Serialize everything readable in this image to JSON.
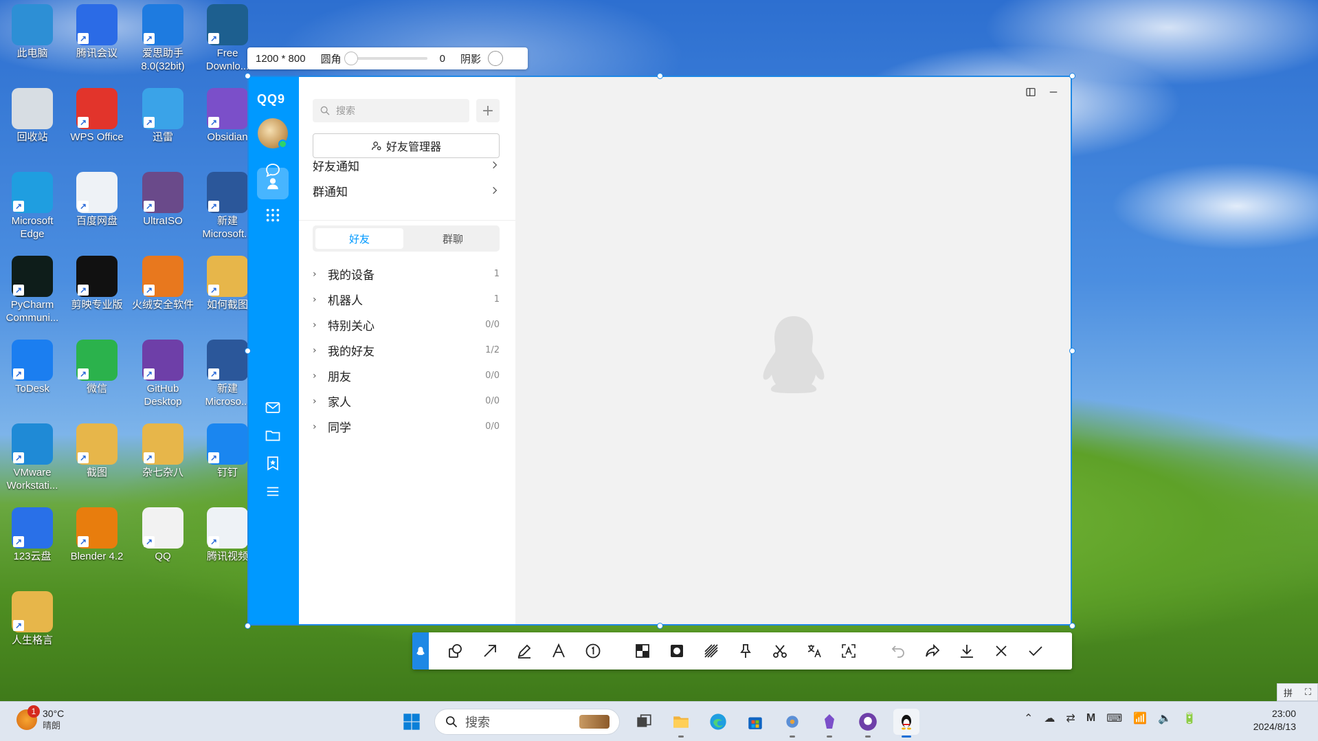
{
  "desktop": {
    "icons": [
      {
        "label": "此电脑",
        "icon": "computer-icon",
        "color": "#2d8fd5"
      },
      {
        "label": "腾讯会议",
        "icon": "tencent-meeting-icon",
        "color": "#2b6be6"
      },
      {
        "label": "爱思助手 8.0(32bit)",
        "icon": "i4-icon",
        "color": "#1e7be0"
      },
      {
        "label": "Free Downlo...",
        "icon": "free-download-icon",
        "color": "#1d5f8f"
      },
      {
        "label": "回收站",
        "icon": "recycle-bin-icon",
        "color": "#d7dde3"
      },
      {
        "label": "WPS Office",
        "icon": "wps-icon",
        "color": "#e2342b"
      },
      {
        "label": "迅雷",
        "icon": "xunlei-icon",
        "color": "#3aa3e8"
      },
      {
        "label": "Obsidian",
        "icon": "obsidian-icon",
        "color": "#7b4fc9"
      },
      {
        "label": "Microsoft Edge",
        "icon": "edge-icon",
        "color": "#1f9ee0"
      },
      {
        "label": "百度网盘",
        "icon": "baidu-pan-icon",
        "color": "#eef2f6"
      },
      {
        "label": "UltraISO",
        "icon": "ultraiso-icon",
        "color": "#6a4a8a"
      },
      {
        "label": "新建 Microsoft...",
        "icon": "word-doc-icon",
        "color": "#2b579a"
      },
      {
        "label": "PyCharm Communi...",
        "icon": "pycharm-icon",
        "color": "#0e1d1a"
      },
      {
        "label": "剪映专业版",
        "icon": "capcut-icon",
        "color": "#111111"
      },
      {
        "label": "火绒安全软件",
        "icon": "huorong-icon",
        "color": "#e8781e"
      },
      {
        "label": "如何截图",
        "icon": "folder-icon",
        "color": "#e7b64a"
      },
      {
        "label": "ToDesk",
        "icon": "todesk-icon",
        "color": "#1b7ef0"
      },
      {
        "label": "微信",
        "icon": "wechat-icon",
        "color": "#2bb24c"
      },
      {
        "label": "GitHub Desktop",
        "icon": "github-icon",
        "color": "#6e3fa8"
      },
      {
        "label": "新建 Microso...",
        "icon": "word-doc-icon",
        "color": "#2b579a"
      },
      {
        "label": "VMware Workstati...",
        "icon": "vmware-icon",
        "color": "#1f8ad6"
      },
      {
        "label": "截图",
        "icon": "folder-icon",
        "color": "#e7b64a"
      },
      {
        "label": "杂七杂八",
        "icon": "folder-icon",
        "color": "#e7b64a"
      },
      {
        "label": "钉钉",
        "icon": "dingtalk-icon",
        "color": "#1a86f0"
      },
      {
        "label": "123云盘",
        "icon": "123pan-icon",
        "color": "#2970e8"
      },
      {
        "label": "Blender 4.2",
        "icon": "blender-icon",
        "color": "#e87d0d"
      },
      {
        "label": "QQ",
        "icon": "qq-icon",
        "color": "#f2f2f2"
      },
      {
        "label": "腾讯视频",
        "icon": "tencent-video-icon",
        "color": "#eef2f6"
      },
      {
        "label": "人生格言",
        "icon": "folder-icon",
        "color": "#e7b64a"
      }
    ]
  },
  "sizebar": {
    "dims": "1200 * 800",
    "radius_label": "圆角",
    "radius_value": "0",
    "shadow_label": "阴影"
  },
  "qq": {
    "logo": "QQ9",
    "search_placeholder": "搜索",
    "add_label": "+",
    "manager_label": "好友管理器",
    "friend_notify": "好友通知",
    "group_notify": "群通知",
    "tabs": {
      "friends": "好友",
      "groups": "群聊"
    },
    "groups": [
      {
        "name": "我的设备",
        "count": "1"
      },
      {
        "name": "机器人",
        "count": "1"
      },
      {
        "name": "特别关心",
        "count": "0/0"
      },
      {
        "name": "我的好友",
        "count": "1/2"
      },
      {
        "name": "朋友",
        "count": "0/0"
      },
      {
        "name": "家人",
        "count": "0/0"
      },
      {
        "name": "同学",
        "count": "0/0"
      }
    ],
    "accent": "#0099ff"
  },
  "toolbar": {
    "tools": [
      "shape-tool-icon",
      "arrow-tool-icon",
      "pen-tool-icon",
      "text-tool-icon",
      "number-tool-icon",
      "mosaic-tool-icon",
      "blur-tool-icon",
      "hatch-tool-icon",
      "pin-tool-icon",
      "crop-tool-icon",
      "translate-tool-icon",
      "ocr-tool-icon",
      "undo-icon",
      "share-icon",
      "download-icon",
      "close-icon",
      "confirm-icon"
    ]
  },
  "taskbar": {
    "temperature": "30°C",
    "weather": "晴朗",
    "weather_badge": "1",
    "search_placeholder": "搜索",
    "time": "23:00",
    "date": "2024/8/13"
  },
  "ime": {
    "label": "拼"
  }
}
